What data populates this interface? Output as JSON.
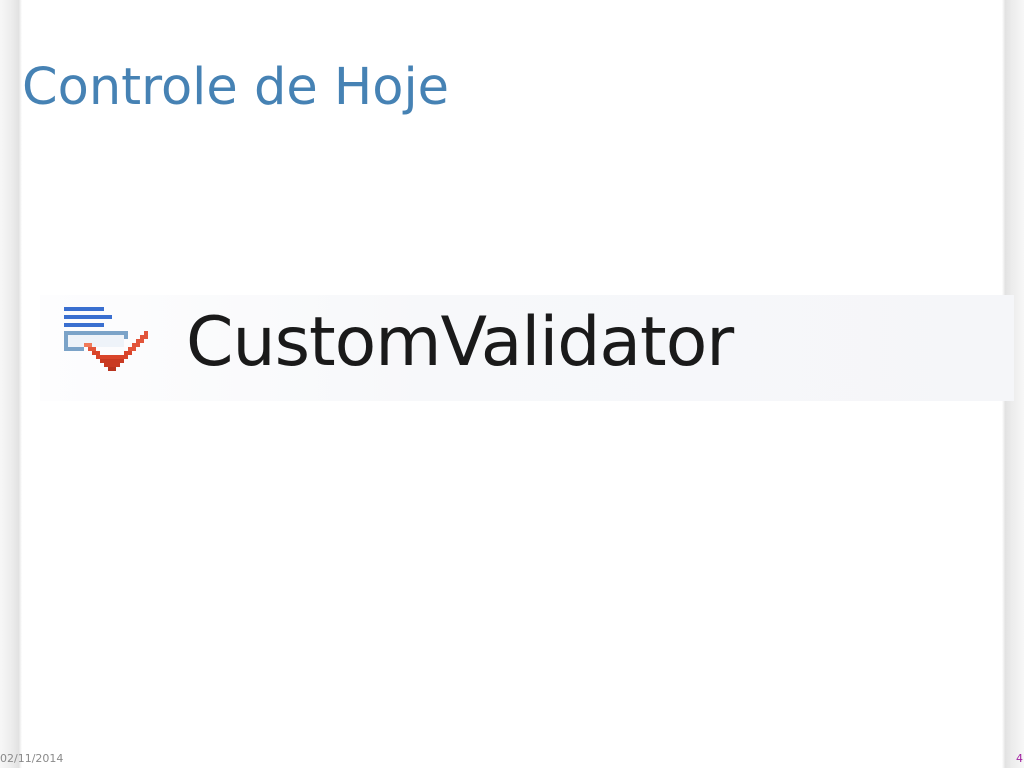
{
  "slide": {
    "title": "Controle de Hoje",
    "date": "02/11/2014",
    "page_number": "4",
    "title_color": "#4682b4"
  },
  "toolbox_item": {
    "label": "CustomValidator",
    "icon": "custom-validator-icon"
  }
}
